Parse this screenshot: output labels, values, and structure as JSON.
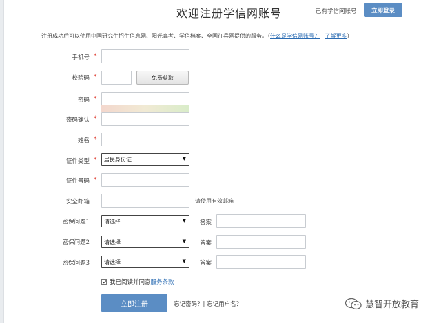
{
  "header": {
    "title": "欢迎注册学信网账号",
    "has_account": "已有学信网账号",
    "login_button": "立即登录"
  },
  "notice": {
    "text": "注册成功后可以使用中国研究生招生信息网、阳光高考、学信档案、全国征兵网提供的服务。（",
    "link_what": "什么是学信网账号？",
    "link_more": "了解更多",
    "close_paren": "）"
  },
  "form": {
    "phone_label": "手机号",
    "code_label": "校验码",
    "get_code_button": "免费获取",
    "password_label": "密码",
    "confirm_label": "密码确认",
    "name_label": "姓名",
    "id_type_label": "证件类型",
    "id_type_value": "居民身份证",
    "id_number_label": "证件号码",
    "email_label": "安全邮箱",
    "email_hint": "请使用有效邮箱",
    "q1_label": "密保问题1",
    "q2_label": "密保问题2",
    "q3_label": "密保问题3",
    "select_placeholder": "请选择",
    "answer_label": "答案",
    "required_mark": "*",
    "agree_text": "我已阅读并同意",
    "terms_link": "服务条款",
    "submit_button": "立即注册",
    "forgot_links": "忘记密码？| 忘记用户名？"
  },
  "watermark": {
    "text": "慧智开放教育"
  },
  "colors": {
    "primary_button": "#5b8dc4",
    "link": "#2b6cb3",
    "required": "#e0463b"
  }
}
